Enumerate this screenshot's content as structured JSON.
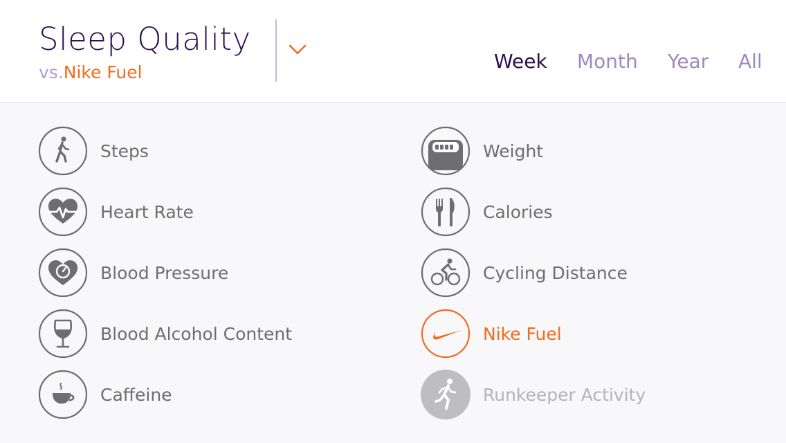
{
  "header": {
    "title": "Sleep Quality",
    "subtitle_prefix": "vs.",
    "subtitle_metric": "Nike Fuel",
    "dropdown_icon": "chevron-down-icon"
  },
  "tabs": [
    {
      "label": "Week",
      "active": true
    },
    {
      "label": "Month",
      "active": false
    },
    {
      "label": "Year",
      "active": false
    },
    {
      "label": "All",
      "active": false
    }
  ],
  "metrics": {
    "left": [
      {
        "label": "Steps",
        "icon": "walking-person-icon"
      },
      {
        "label": "Heart Rate",
        "icon": "heart-pulse-icon"
      },
      {
        "label": "Blood Pressure",
        "icon": "heart-gauge-icon"
      },
      {
        "label": "Blood Alcohol Content",
        "icon": "wine-glass-icon"
      },
      {
        "label": "Caffeine",
        "icon": "coffee-cup-icon"
      }
    ],
    "right": [
      {
        "label": "Weight",
        "icon": "scale-icon"
      },
      {
        "label": "Calories",
        "icon": "fork-knife-icon"
      },
      {
        "label": "Cycling Distance",
        "icon": "cyclist-icon"
      },
      {
        "label": "Nike Fuel",
        "icon": "nike-swoosh-icon",
        "state": "selected"
      },
      {
        "label": "Runkeeper Activity",
        "icon": "runner-icon",
        "state": "disabled"
      }
    ]
  },
  "colors": {
    "title": "#2b0f4f",
    "accent": "#f26b1d",
    "muted_purple": "#9e88bf",
    "icon_gray": "#6d6d72",
    "disabled_gray": "#b3b3b8"
  }
}
